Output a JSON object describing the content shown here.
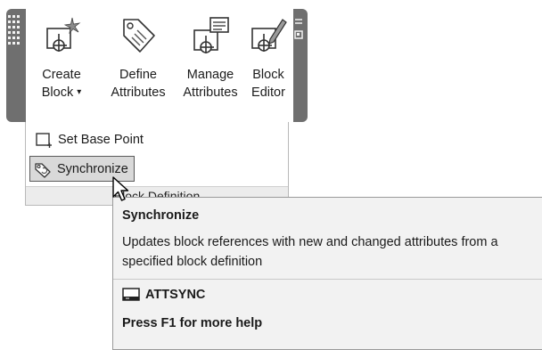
{
  "ribbon": {
    "buttons": [
      {
        "label_line1": "Create",
        "label_line2": "Block",
        "dropdown": "▾",
        "icon": "create-block-icon"
      },
      {
        "label_line1": "Define",
        "label_line2": "Attributes",
        "icon": "define-attributes-icon"
      },
      {
        "label_line1": "Manage",
        "label_line2": "Attributes",
        "icon": "manage-attributes-icon"
      },
      {
        "label_line1": "Block",
        "label_line2": "Editor",
        "icon": "block-editor-icon"
      }
    ],
    "panel": {
      "set_base_point": "Set Base Point",
      "synchronize": "Synchronize",
      "title": "Block Definition"
    }
  },
  "tooltip": {
    "title": "Synchronize",
    "description_line1": "Updates block references with new and changed attributes from a",
    "description_line2": "specified block definition",
    "command": "ATTSYNC",
    "help": "Press F1 for more help"
  },
  "colors": {
    "ribbon_frame": "#6f6f6f",
    "hover_fill": "#d9d9d9",
    "tooltip_bg": "#f2f2f2"
  }
}
